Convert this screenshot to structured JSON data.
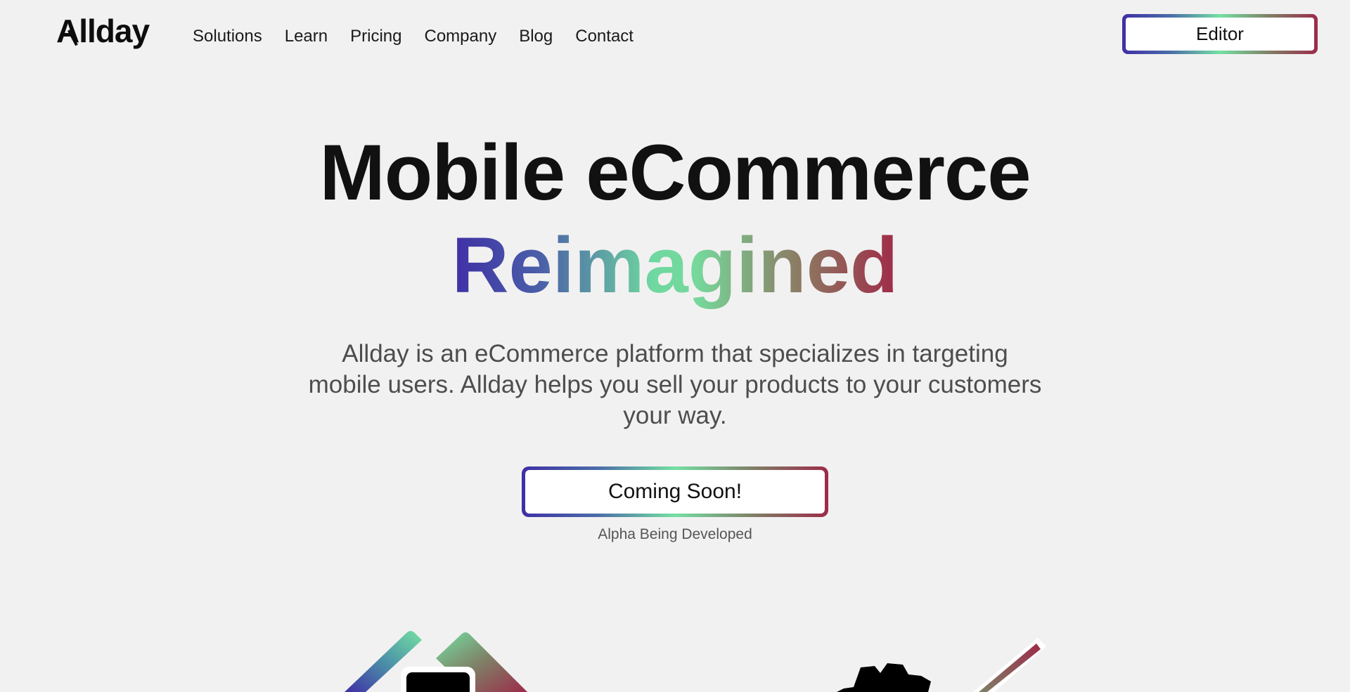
{
  "brand": {
    "logo_text": "Allday"
  },
  "nav": {
    "items": [
      {
        "label": "Solutions"
      },
      {
        "label": "Learn"
      },
      {
        "label": "Pricing"
      },
      {
        "label": "Company"
      },
      {
        "label": "Blog"
      },
      {
        "label": "Contact"
      }
    ]
  },
  "header": {
    "editor_label": "Editor"
  },
  "hero": {
    "title": "Mobile eCommerce",
    "subtitle": "Reimagined",
    "description": "Allday is an eCommerce platform that specializes in targeting mobile users. Allday helps you sell your products to your customers your way.",
    "cta_label": "Coming Soon!",
    "cta_note": "Alpha Being Developed"
  },
  "colors": {
    "background": "#f2f1f1",
    "gradient": [
      "#3f2fa6",
      "#4b6ea8",
      "#74e0a3",
      "#7f8066",
      "#9c2b4a"
    ],
    "text": "#111111",
    "muted_text": "#4d4d4d"
  },
  "illustrations": {
    "left": "mobile-store-graphic",
    "right": "gear-wrench-graphic"
  }
}
